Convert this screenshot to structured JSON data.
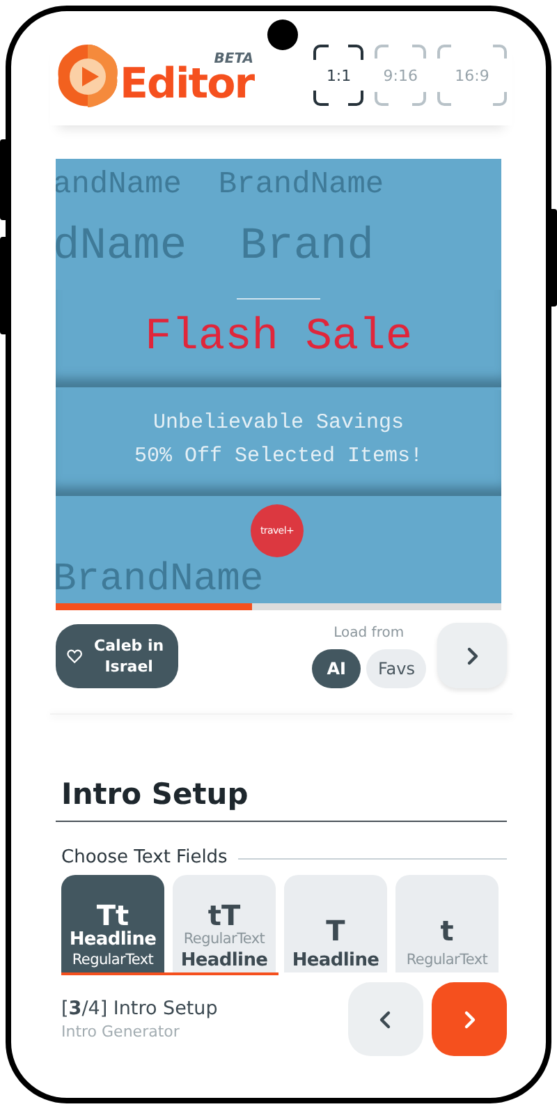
{
  "header": {
    "logo_text": "Editor",
    "badge": "BETA",
    "aspect_ratios": [
      {
        "label": "1:1",
        "selected": true
      },
      {
        "label": "9:16",
        "selected": false
      },
      {
        "label": "16:9",
        "selected": false
      }
    ]
  },
  "preview": {
    "background_text": [
      "andName  BrandName",
      "dName  Brand",
      "BrandName"
    ],
    "headline": "Flash Sale",
    "subtext": [
      "Unbelievable Savings",
      "50% Off Selected Items!"
    ],
    "logo_text": "travel+",
    "progress": {
      "level": 0.44
    }
  },
  "profile_button": {
    "label": "Caleb in Israel"
  },
  "load_from": {
    "label": "Load from",
    "options": [
      {
        "label": "AI",
        "selected": true
      },
      {
        "label": "Favs",
        "selected": false
      }
    ]
  },
  "section": {
    "title": "Intro Setup",
    "subtitle": "Choose Text Fields",
    "options": [
      {
        "glyph": "Tt",
        "selected": true,
        "lines": [
          {
            "kind": "headline",
            "text": "Headline"
          },
          {
            "kind": "regular",
            "text": "RegularText"
          }
        ]
      },
      {
        "glyph": "tT",
        "selected": false,
        "lines": [
          {
            "kind": "regular",
            "text": "RegularText"
          },
          {
            "kind": "headline",
            "text": "Headline"
          }
        ]
      },
      {
        "glyph": "T",
        "selected": false,
        "lines": [
          {
            "kind": "headline",
            "text": "Headline"
          }
        ]
      },
      {
        "glyph": "t",
        "selected": false,
        "lines": [
          {
            "kind": "regular",
            "text": "RegularText"
          }
        ]
      }
    ]
  },
  "footer": {
    "step": "[**3**/4] Intro Setup",
    "subtitle": "Intro Generator"
  }
}
